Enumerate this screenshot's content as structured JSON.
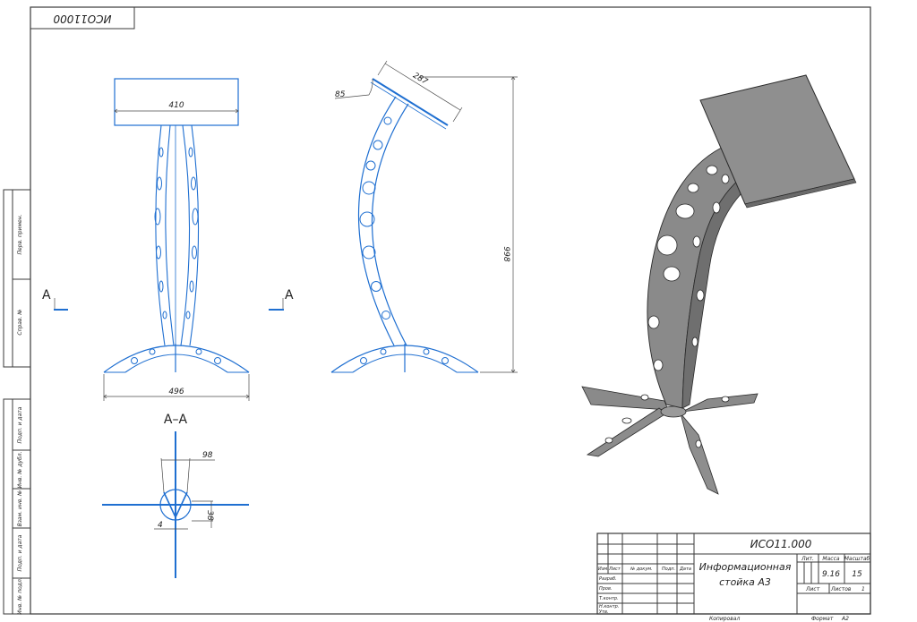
{
  "stamp_code": "ИСО11000",
  "left_strip": [
    "Перв. примен.",
    "Справ. №",
    "Подп. и дата",
    "Инв. № дубл.",
    "Взам. инв. №",
    "Подп. и дата",
    "Инв. № подл."
  ],
  "dims": {
    "width_top": "410",
    "base_width": "496",
    "angle": "85",
    "plate_len": "287",
    "height": "998",
    "sec_98": "98",
    "sec_38": "38",
    "sec_4": "4"
  },
  "section_markers": {
    "left": "A",
    "right": "A",
    "title": "A–A"
  },
  "title_block": {
    "code": "ИСО11.000",
    "name_line1": "Информационная",
    "name_line2": "стойка А3",
    "hdr_lit": "Лит.",
    "hdr_mass": "Масса",
    "hdr_scale": "Масштаб",
    "mass": "9.16",
    "scale": "15",
    "sheet": "Лист",
    "sheets": "Листов",
    "sheets_val": "1",
    "rows": [
      "Изм.",
      "Лист",
      "№ докум.",
      "Подп.",
      "Дата"
    ],
    "roles": [
      "Разраб.",
      "Пров.",
      "Т.контр.",
      "Н.контр.",
      "Утв."
    ],
    "copied": "Копировал",
    "format": "Формат",
    "format_val": "А2"
  }
}
